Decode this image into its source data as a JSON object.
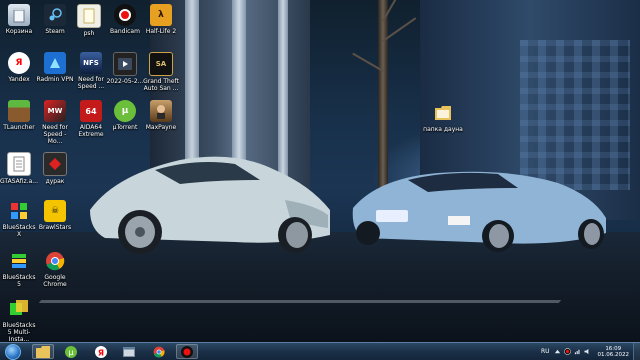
{
  "desktop": {
    "icons": [
      {
        "id": "recycle",
        "label": "Корзина"
      },
      {
        "id": "steam",
        "label": "Steam"
      },
      {
        "id": "psh",
        "label": "psh"
      },
      {
        "id": "bandicam",
        "label": "Bandicam"
      },
      {
        "id": "halflife2",
        "label": "Half-Life 2"
      },
      {
        "id": "yandex",
        "label": "Yandex"
      },
      {
        "id": "radmin",
        "label": "Radmin VPN"
      },
      {
        "id": "nfs_speed",
        "label": "Need for Speed ..."
      },
      {
        "id": "video2022",
        "label": "2022-05-2..."
      },
      {
        "id": "gta_sa",
        "label": "Grand Theft Auto San ..."
      },
      {
        "id": "tlauncher",
        "label": "TLauncher"
      },
      {
        "id": "nfs_most",
        "label": "Need for Speed - Mo..."
      },
      {
        "id": "aida64",
        "label": "AIDA64 Extreme"
      },
      {
        "id": "utorrent",
        "label": "µTorrent"
      },
      {
        "id": "maxpayne",
        "label": "MaxPayne"
      },
      {
        "id": "gtasa_file",
        "label": "GTASAfiz.a..."
      },
      {
        "id": "dyrak",
        "label": "дурак"
      },
      {
        "id": "bluestacks_x",
        "label": "BlueStacks X"
      },
      {
        "id": "brawlstars",
        "label": "BrawlStars"
      },
      {
        "id": "bluestacks5",
        "label": "BlueStacks 5"
      },
      {
        "id": "chrome",
        "label": "Google Chrome"
      },
      {
        "id": "bluestacks5_multi",
        "label": "BlueStacks 5 Multi-Insta..."
      },
      {
        "id": "folder_dauna",
        "label": "папка дауна"
      }
    ]
  },
  "taskbar": {
    "pinned": [
      {
        "id": "explorer",
        "icon": "folder-icon",
        "active": true
      },
      {
        "id": "utorrent",
        "icon": "utorrent-icon",
        "active": false
      },
      {
        "id": "yandex",
        "icon": "yandex-icon",
        "active": false
      },
      {
        "id": "terminal",
        "icon": "window-icon",
        "active": false
      },
      {
        "id": "chrome",
        "icon": "chrome-icon",
        "active": false
      },
      {
        "id": "bandicam",
        "icon": "record-icon",
        "active": true
      }
    ],
    "tray": {
      "language": "RU",
      "time": "16:09",
      "date": "01.06.2022"
    }
  },
  "colors": {
    "taskbar": "#1b3048",
    "accent": "#2b74c4"
  }
}
